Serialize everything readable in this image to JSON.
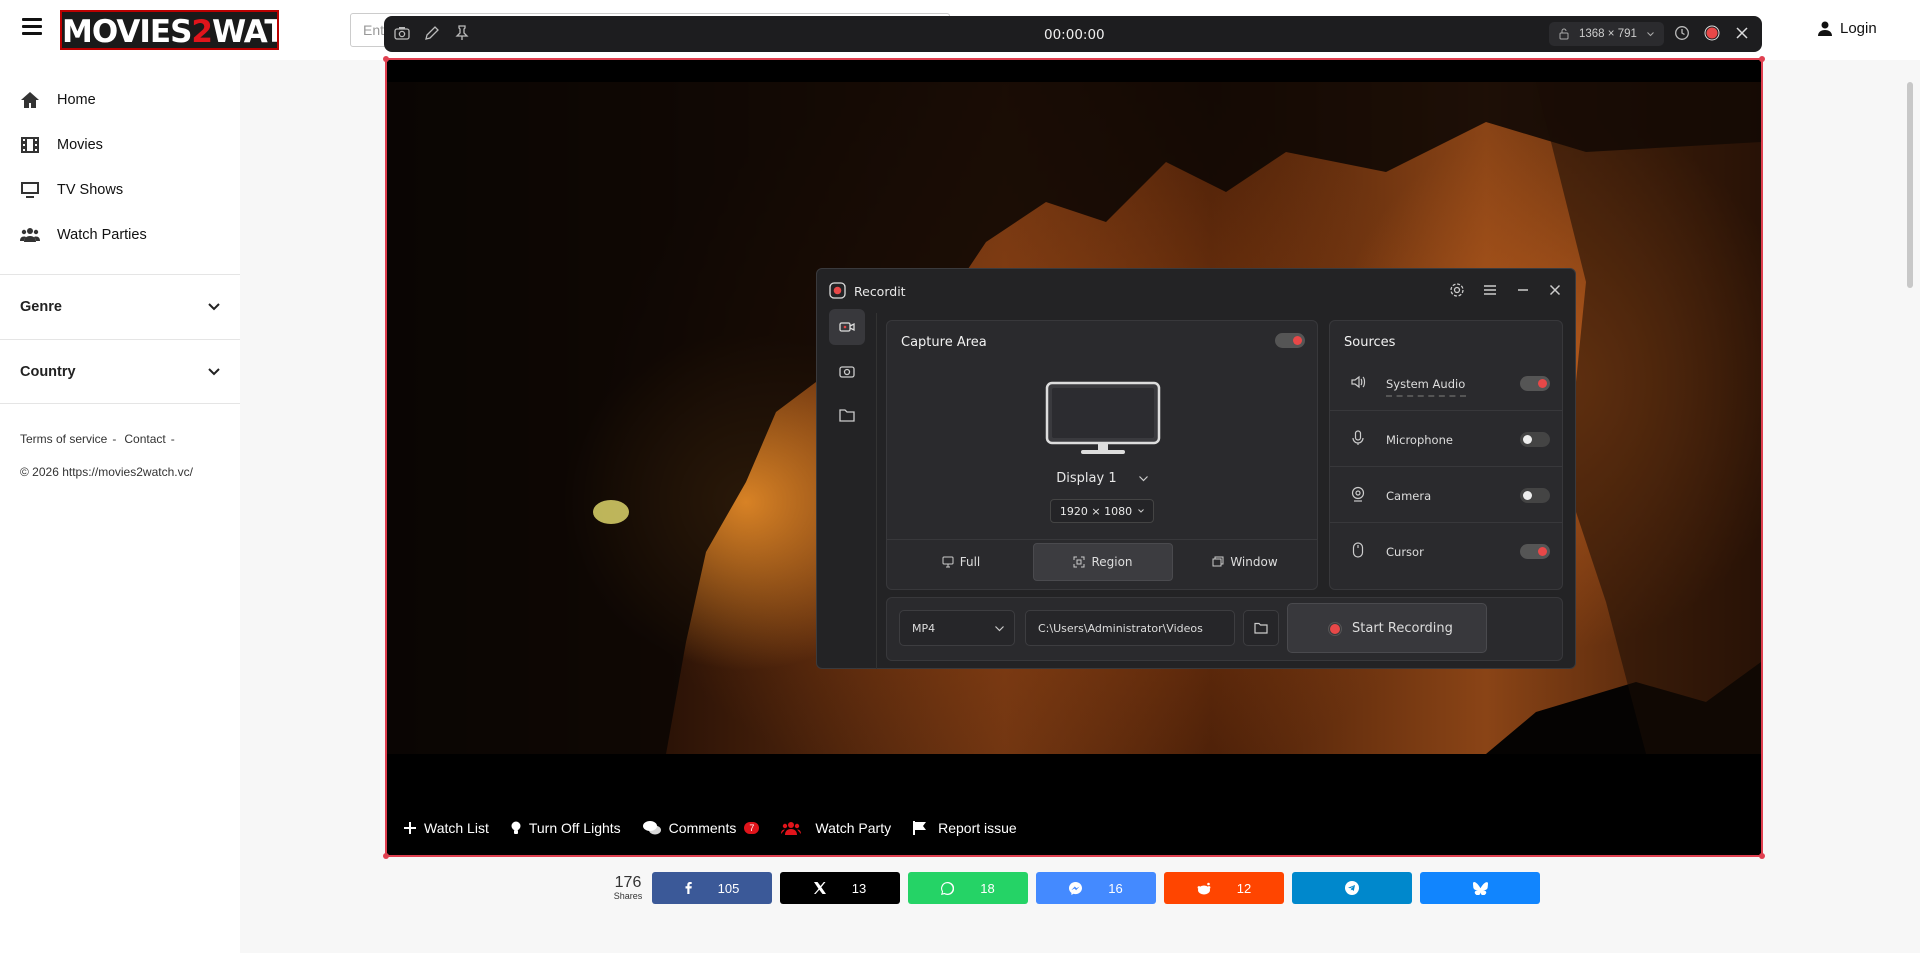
{
  "site": {
    "logo_text": "MOVIES",
    "logo_two": "2",
    "logo_text2": "WATCH",
    "search_placeholder": "Ent",
    "login_label": "Login"
  },
  "sidebar": {
    "items": [
      {
        "label": "Home",
        "icon": "home-icon"
      },
      {
        "label": "Movies",
        "icon": "film-icon"
      },
      {
        "label": "TV Shows",
        "icon": "tv-icon"
      },
      {
        "label": "Watch Parties",
        "icon": "users-icon"
      }
    ],
    "dropdowns": [
      {
        "label": "Genre"
      },
      {
        "label": "Country"
      }
    ],
    "footer": {
      "terms": "Terms of service",
      "sep": "-",
      "contact": "Contact",
      "sep2": "-",
      "copyright": "© 2026 https://movies2watch.vc/"
    }
  },
  "player_controls": {
    "watch_list": "Watch List",
    "lights": "Turn Off Lights",
    "comments": "Comments",
    "comments_count": "7",
    "watch_party": "Watch Party",
    "report": "Report issue"
  },
  "share": {
    "total": "176",
    "total_label": "Shares",
    "buttons": [
      {
        "network": "facebook",
        "count": "105",
        "color": "#3b5998"
      },
      {
        "network": "x",
        "count": "13",
        "color": "#000000"
      },
      {
        "network": "whatsapp",
        "count": "18",
        "color": "#25d366"
      },
      {
        "network": "messenger",
        "count": "16",
        "color": "#448aff"
      },
      {
        "network": "reddit",
        "count": "12",
        "color": "#ff4500"
      },
      {
        "network": "telegram",
        "count": "",
        "color": "#0088cc"
      },
      {
        "network": "bluesky",
        "count": "",
        "color": "#1185fe"
      }
    ]
  },
  "recorder_toolbar": {
    "timer": "00:00:00",
    "dimensions": "1368 × 791"
  },
  "recordit": {
    "title": "Recordit",
    "capture": {
      "title": "Capture Area",
      "display": "Display 1",
      "resolution": "1920 × 1080",
      "modes": [
        "Full",
        "Region",
        "Window"
      ],
      "active_mode": "Region"
    },
    "sources": {
      "title": "Sources",
      "items": [
        {
          "label": "System Audio",
          "on": true
        },
        {
          "label": "Microphone",
          "on": false
        },
        {
          "label": "Camera",
          "on": false
        },
        {
          "label": "Cursor",
          "on": true
        }
      ]
    },
    "output": {
      "format": "MP4",
      "path": "C:\\Users\\Administrator\\Videos",
      "start_label": "Start Recording"
    },
    "colors": {
      "accent": "#e84848",
      "bg": "#232325"
    }
  }
}
